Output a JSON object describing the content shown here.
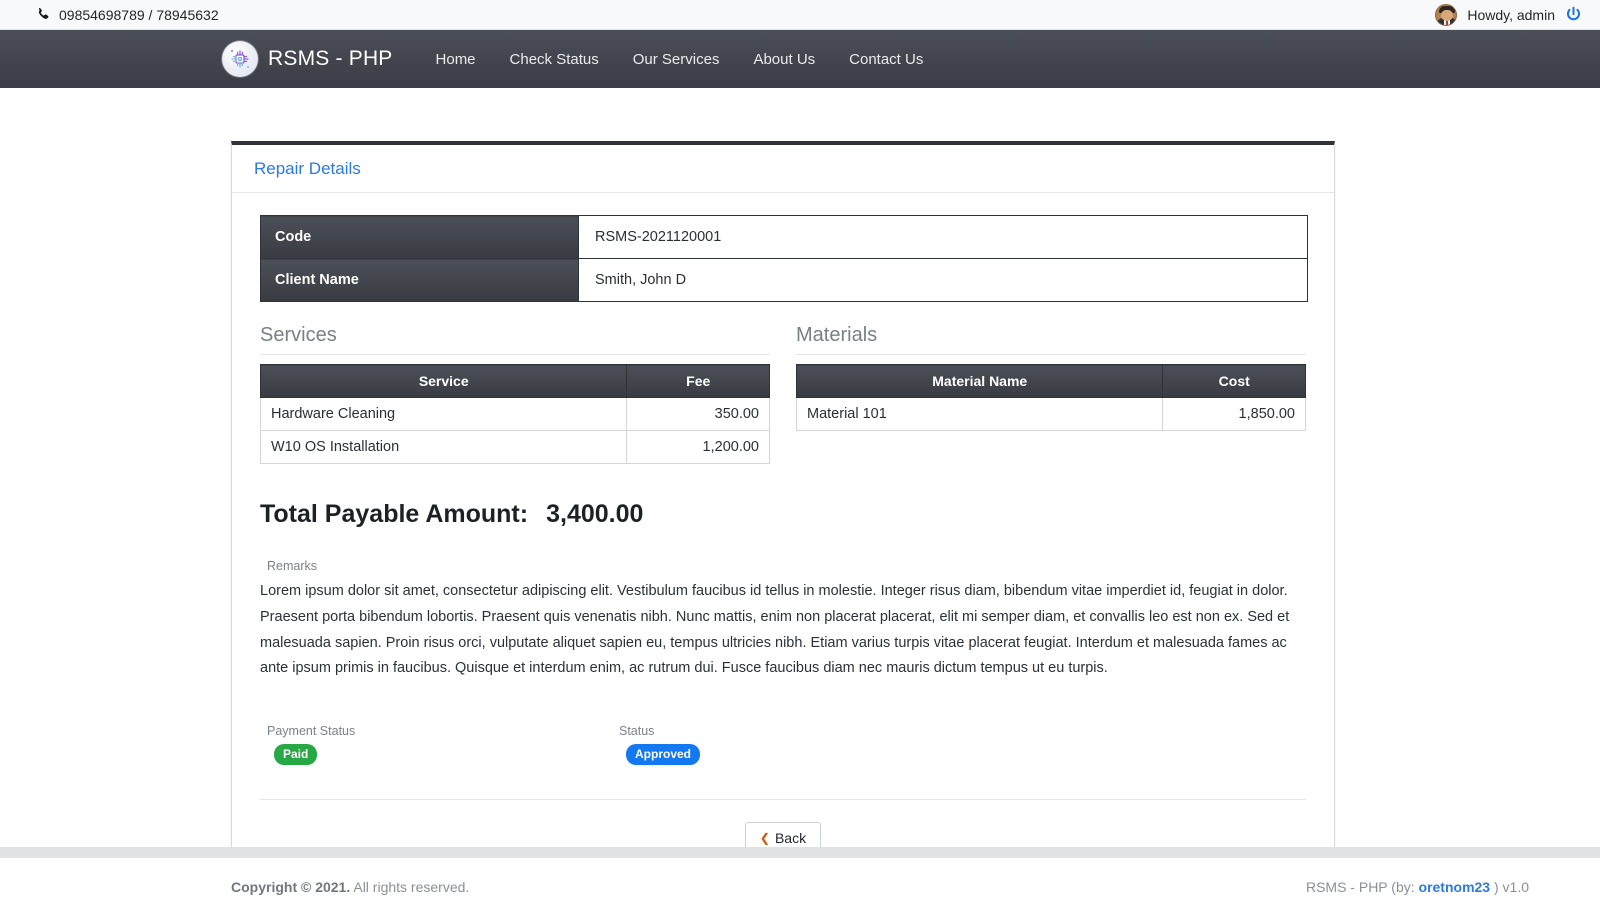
{
  "topbar": {
    "phone": "09854698789 / 78945632",
    "phone_icon": "phone-icon",
    "greeting": "Howdy, admin",
    "power_icon": "power-icon"
  },
  "navbar": {
    "brand": "RSMS - PHP",
    "logo_icon": "microchip-icon",
    "links": [
      {
        "label": "Home"
      },
      {
        "label": "Check Status"
      },
      {
        "label": "Our Services"
      },
      {
        "label": "About Us"
      },
      {
        "label": "Contact Us"
      }
    ]
  },
  "card": {
    "title": "Repair Details",
    "info": [
      {
        "label": "Code",
        "value": "RSMS-2021120001"
      },
      {
        "label": "Client Name",
        "value": "Smith, John D"
      }
    ],
    "services": {
      "heading": "Services",
      "columns": [
        "Service",
        "Fee"
      ],
      "rows": [
        {
          "name": "Hardware Cleaning",
          "amount": "350.00"
        },
        {
          "name": "W10 OS Installation",
          "amount": "1,200.00"
        }
      ]
    },
    "materials": {
      "heading": "Materials",
      "columns": [
        "Material Name",
        "Cost"
      ],
      "rows": [
        {
          "name": "Material 101",
          "amount": "1,850.00"
        }
      ]
    },
    "total": {
      "label": "Total Payable Amount:",
      "value": "3,400.00"
    },
    "remarks": {
      "label": "Remarks",
      "text": "Lorem ipsum dolor sit amet, consectetur adipiscing elit. Vestibulum faucibus id tellus in molestie. Integer risus diam, bibendum vitae imperdiet id, feugiat in dolor. Praesent porta bibendum lobortis. Praesent quis venenatis nibh. Nunc mattis, enim non placerat placerat, elit mi semper diam, et convallis leo est non ex. Sed et malesuada sapien. Proin risus orci, vulputate aliquet sapien eu, tempus ultricies nibh. Etiam varius turpis vitae placerat feugiat. Interdum et malesuada fames ac ante ipsum primis in faucibus. Quisque et interdum enim, ac rutrum dui. Fusce faucibus diam nec mauris dictum tempus ut eu turpis."
    },
    "payment_status": {
      "label": "Payment Status",
      "value": "Paid",
      "color": "#28a745"
    },
    "status": {
      "label": "Status",
      "value": "Approved",
      "color": "#1478f0"
    },
    "back_button": {
      "label": "Back",
      "icon": "chevron-left-icon"
    }
  },
  "footer": {
    "copyright_strong": "Copyright © 2021.",
    "copyright_rest": " All rights reserved.",
    "credit_prefix": "RSMS - PHP (by: ",
    "credit_author": "oretnom23",
    "credit_suffix": " ) v1.0"
  }
}
